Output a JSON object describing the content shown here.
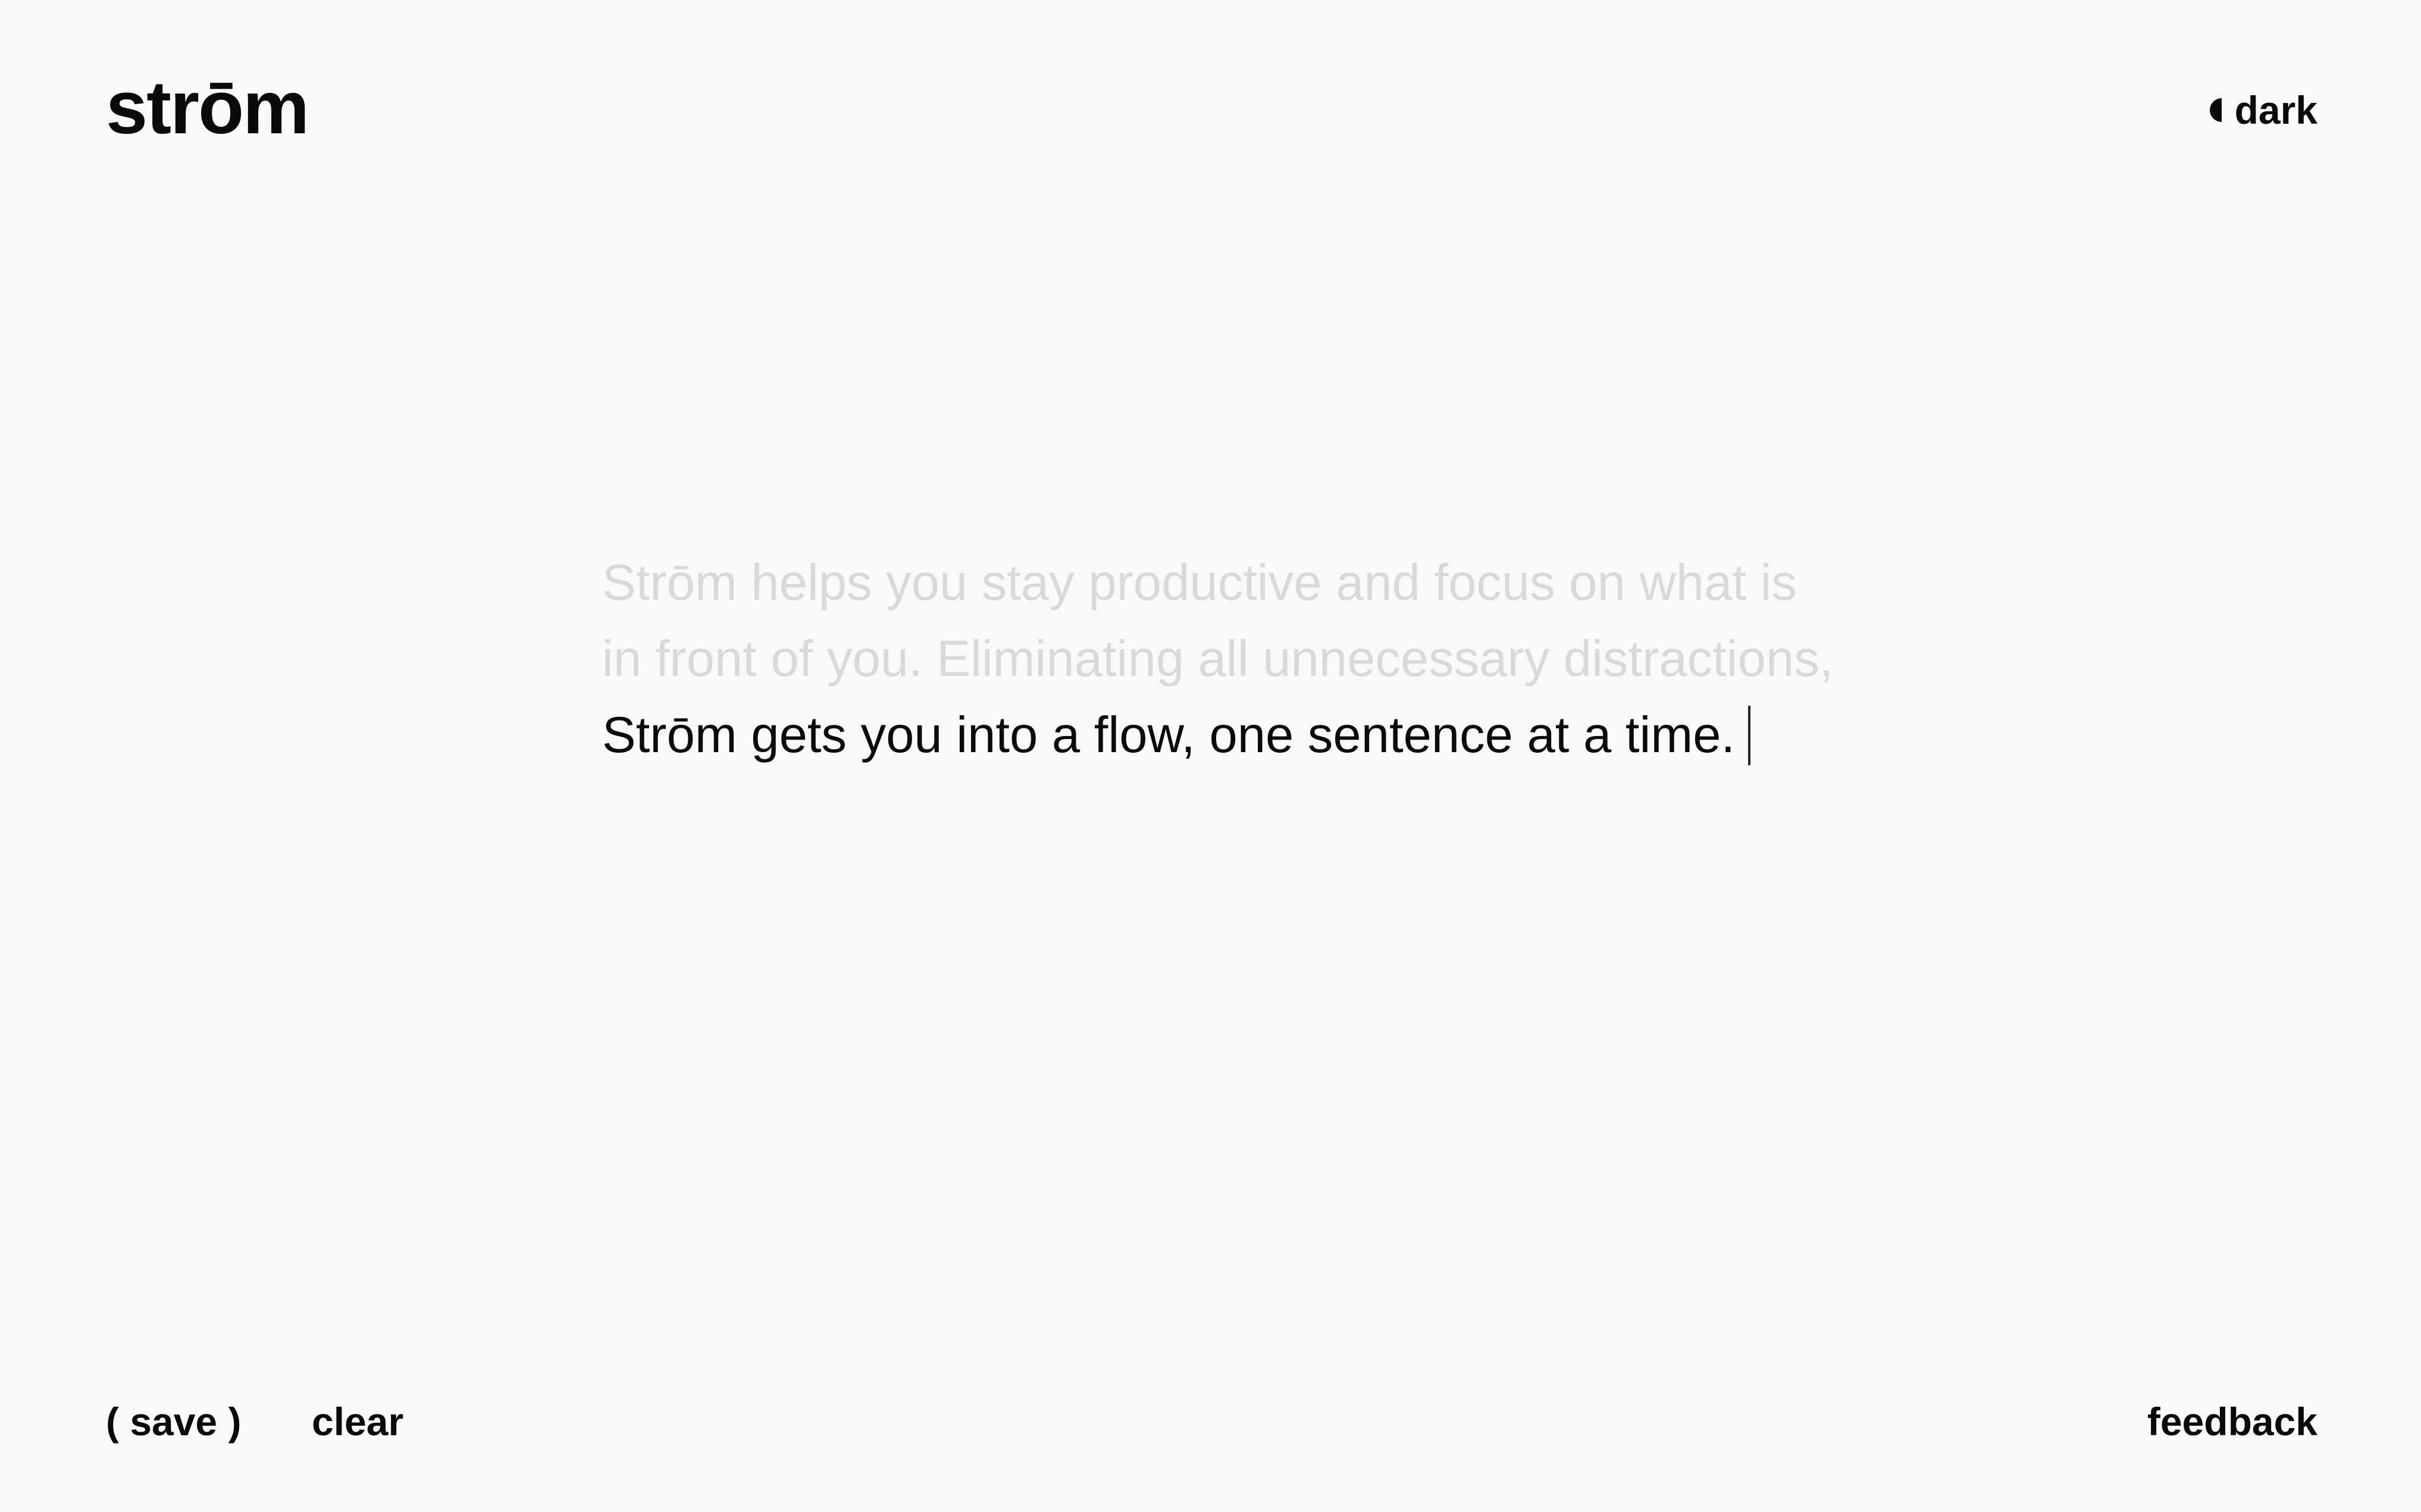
{
  "header": {
    "logo": "strōm",
    "theme_toggle_label": "dark",
    "theme_icon": "half-moon-icon"
  },
  "editor": {
    "previous_lines": [
      "Strōm helps you stay productive and focus on what is",
      "in front of you. Eliminating all unnecessary distractions,"
    ],
    "current_line": "Strōm gets you into a flow, one sentence at a time."
  },
  "footer": {
    "save_label": "( save )",
    "clear_label": "clear",
    "feedback_label": "feedback"
  },
  "colors": {
    "background": "#f9f9f9",
    "text": "#0a0a0a",
    "faded_text": "#d9d9d9"
  }
}
